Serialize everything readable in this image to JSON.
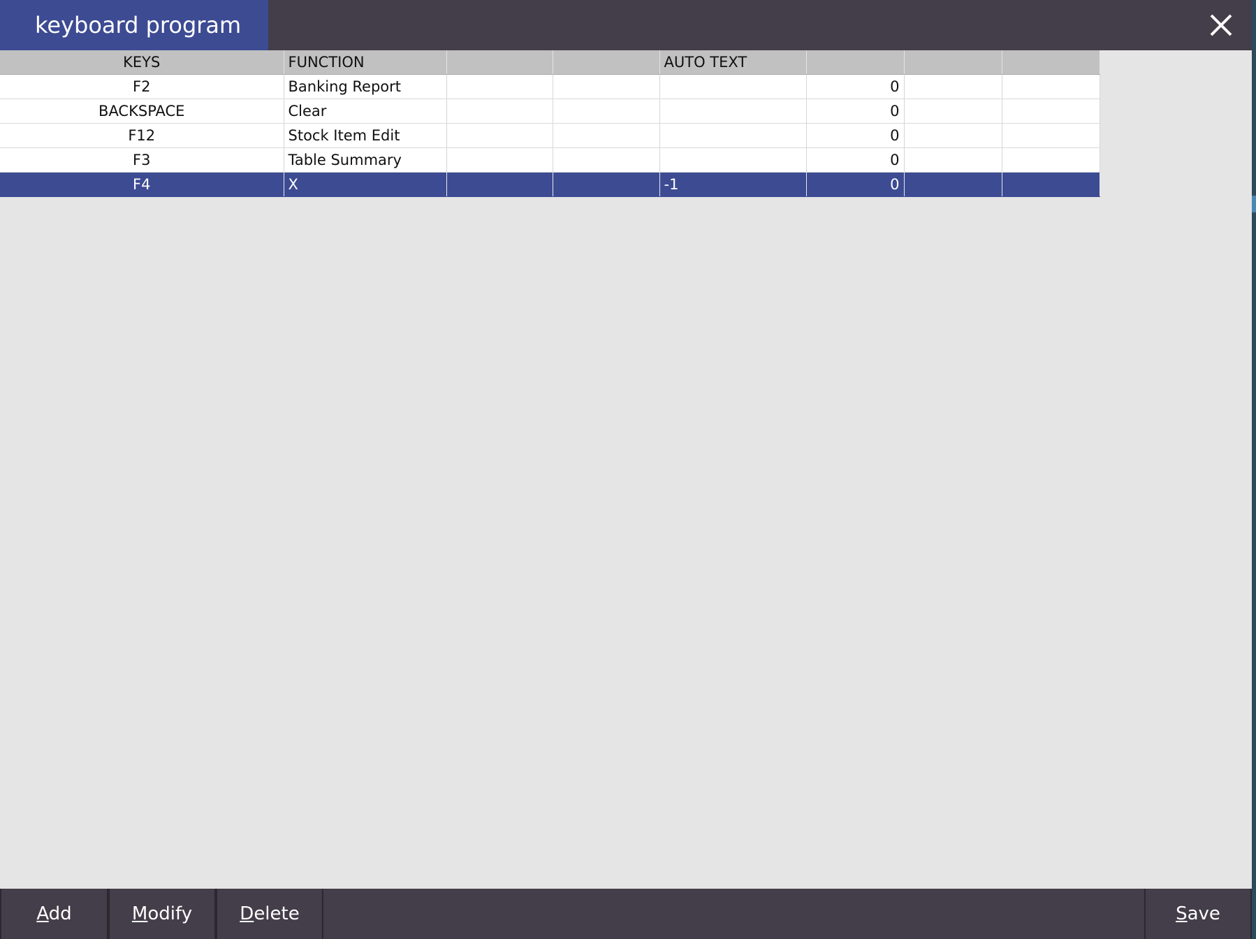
{
  "window": {
    "title": "keyboard program"
  },
  "colors": {
    "title_tab": "#3d4b93",
    "title_bar": "#433e49",
    "selected_row": "#3d4b93",
    "header_bg": "#c1c1c1",
    "body_bg": "#e5e5e5"
  },
  "icons": {
    "close": "close-icon"
  },
  "table": {
    "columns": [
      "KEYS",
      "FUNCTION",
      "",
      "",
      "AUTO TEXT",
      "",
      "",
      ""
    ],
    "rows": [
      {
        "key": "F2",
        "function": "Banking Report",
        "col3": "",
        "col4": "",
        "auto_text": "",
        "col6": "0",
        "col7": "",
        "col8": ""
      },
      {
        "key": "BACKSPACE",
        "function": "Clear",
        "col3": "",
        "col4": "",
        "auto_text": "",
        "col6": "0",
        "col7": "",
        "col8": ""
      },
      {
        "key": "F12",
        "function": "Stock Item Edit",
        "col3": "",
        "col4": "",
        "auto_text": "",
        "col6": "0",
        "col7": "",
        "col8": ""
      },
      {
        "key": "F3",
        "function": "Table Summary",
        "col3": "",
        "col4": "",
        "auto_text": "",
        "col6": "0",
        "col7": "",
        "col8": ""
      },
      {
        "key": "F4",
        "function": "X",
        "col3": "",
        "col4": "",
        "auto_text": "-1",
        "col6": "0",
        "col7": "",
        "col8": "",
        "selected": true
      }
    ]
  },
  "buttons": {
    "add": {
      "mnemonic": "A",
      "rest": "dd"
    },
    "modify": {
      "mnemonic": "M",
      "rest": "odify"
    },
    "delete": {
      "mnemonic": "D",
      "rest": "elete"
    },
    "save": {
      "mnemonic": "S",
      "rest": "ave"
    }
  }
}
